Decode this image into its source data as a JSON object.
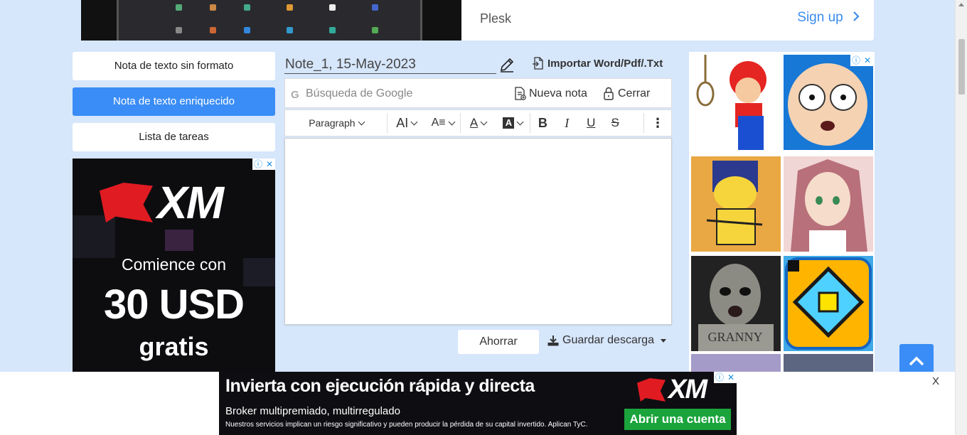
{
  "top_ad": {
    "brand": "Plesk",
    "cta": "Sign up",
    "cta_icon": "chevron-right-icon"
  },
  "modes": [
    {
      "label": "Nota de texto sin formato",
      "active": false
    },
    {
      "label": "Nota de texto enriquecido",
      "active": true
    },
    {
      "label": "Lista de tareas",
      "active": false
    }
  ],
  "left_ad": {
    "brand": "XM",
    "line1": "Comience con",
    "line2": "30 USD",
    "line3": "gratis"
  },
  "editor": {
    "note_title": "Note_1, 15-May-2023",
    "import_label": "Importar Word/Pdf/.Txt",
    "search_placeholder": "Búsqueda de Google",
    "new_note_label": "Nueva nota",
    "close_label": "Cerrar",
    "paragraph_select": "Paragraph",
    "save_label": "Ahorrar",
    "download_label": "Guardar descarga"
  },
  "bottom_ad": {
    "headline": "Invierta con ejecución rápida y directa",
    "subline": "Broker multipremiado, multirregulado",
    "disclaimer": "Nuestros servicios implican un riesgo significativo y pueden producir la pérdida de su capital invertido. Aplican TyC.",
    "cta": "Abrir una cuenta",
    "brand": "XM",
    "close": "X"
  },
  "colors": {
    "page_bg": "#d6e6fb",
    "accent": "#3a8df6",
    "xm_red": "#e11b22",
    "cta_green": "#1aa43b"
  }
}
